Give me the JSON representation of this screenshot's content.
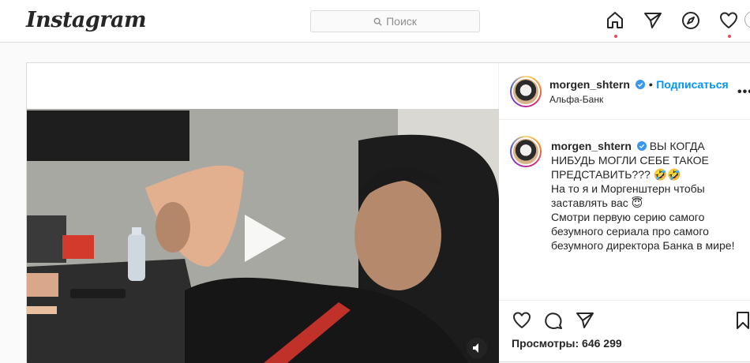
{
  "app": {
    "logo": "Instagram"
  },
  "search": {
    "placeholder": "Поиск"
  },
  "nav": {
    "icons": [
      "home-icon",
      "direct-icon",
      "explore-icon",
      "activity-heart-icon",
      "profile-avatar"
    ]
  },
  "post": {
    "username": "morgen_shtern",
    "follow_separator": "•",
    "follow_label": "Подписаться",
    "location": "Альфа-Банк",
    "more_label": "•••",
    "caption": {
      "username": "morgen_shtern",
      "lines": [
        "ВЫ КОГДА НИБУДЬ МОГЛИ СЕБЕ ТАКОЕ ПРЕДСТАВИТЬ??? 🤣🤣",
        "На то я и Моргенштерн чтобы заставлять вас 😇",
        "Смотри первую серию самого безумного сериала про самого безумного директора Банка в мире!"
      ]
    },
    "views_label": "Просмотры: 646 299",
    "colors": {
      "accent": "#0095f6",
      "verified": "#3897f0",
      "notification": "#ed4956"
    }
  }
}
